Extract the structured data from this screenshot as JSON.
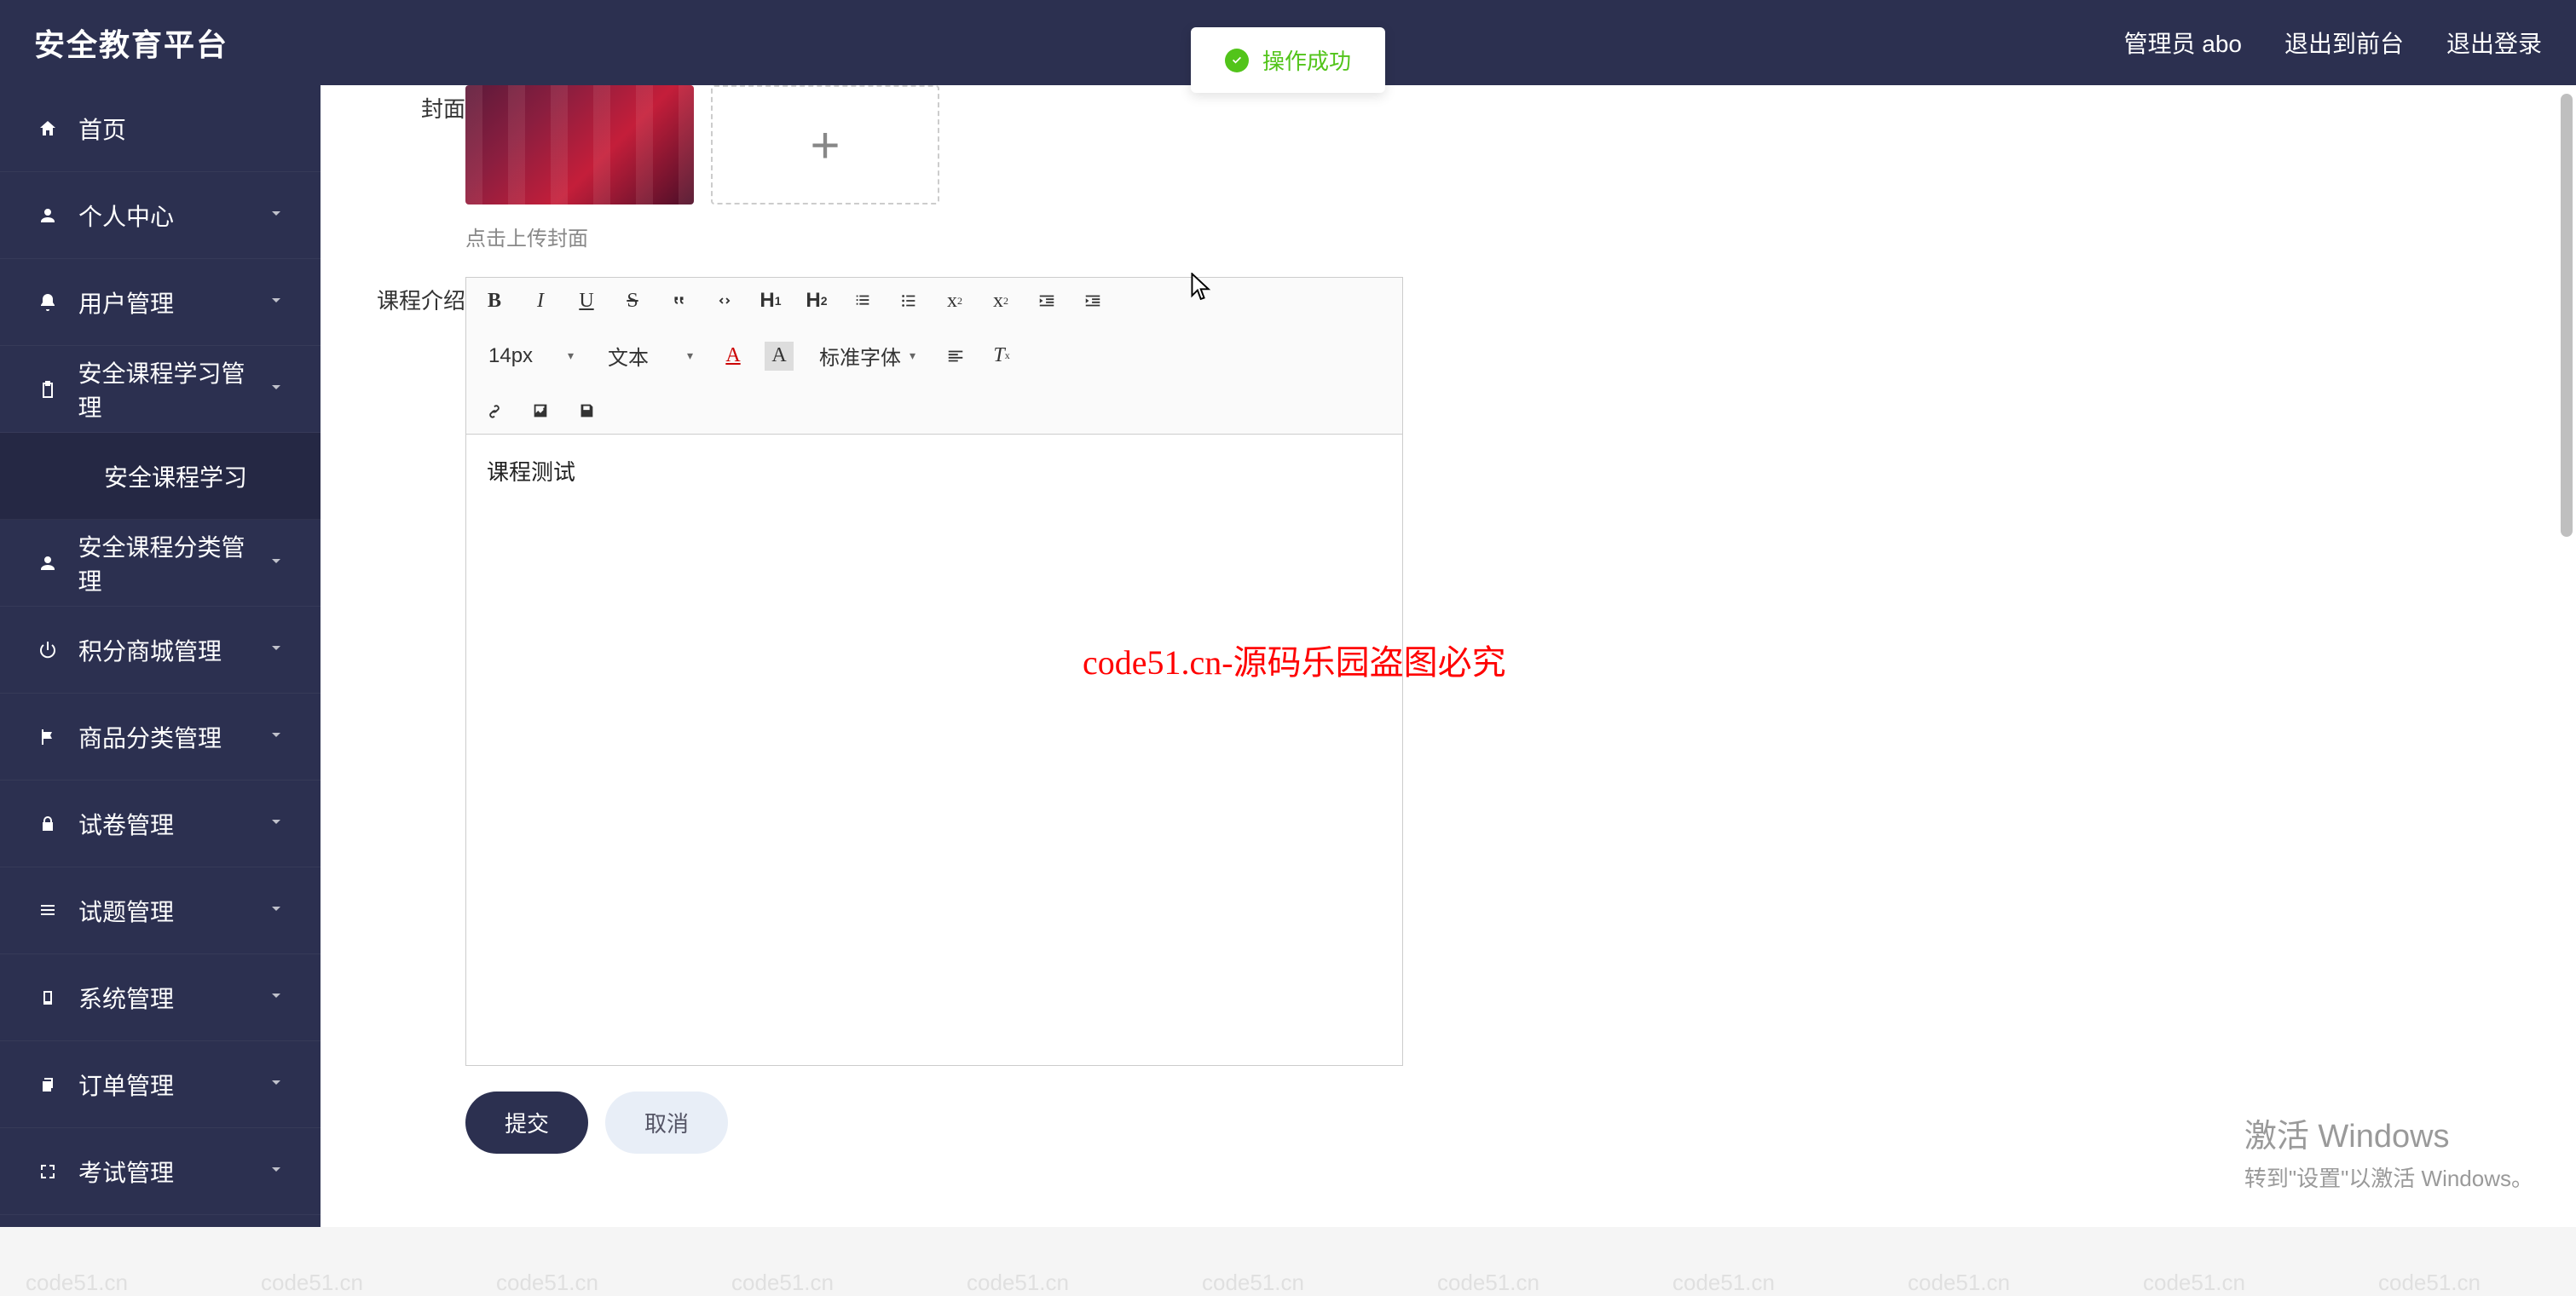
{
  "header": {
    "logo": "安全教育平台",
    "admin": "管理员 abo",
    "exit_front": "退出到前台",
    "logout": "退出登录"
  },
  "sidebar": {
    "items": [
      {
        "label": "首页",
        "icon": "home",
        "expandable": false
      },
      {
        "label": "个人中心",
        "icon": "user",
        "expandable": true
      },
      {
        "label": "用户管理",
        "icon": "bell",
        "expandable": true
      },
      {
        "label": "安全课程学习管理",
        "icon": "clipboard",
        "expandable": true
      },
      {
        "label": "安全课程学习",
        "icon": "",
        "expandable": false,
        "sub": true
      },
      {
        "label": "安全课程分类管理",
        "icon": "user",
        "expandable": true
      },
      {
        "label": "积分商城管理",
        "icon": "power",
        "expandable": true
      },
      {
        "label": "商品分类管理",
        "icon": "flag",
        "expandable": true
      },
      {
        "label": "试卷管理",
        "icon": "lock",
        "expandable": true
      },
      {
        "label": "试题管理",
        "icon": "list",
        "expandable": true
      },
      {
        "label": "系统管理",
        "icon": "device",
        "expandable": true
      },
      {
        "label": "订单管理",
        "icon": "copy",
        "expandable": true
      },
      {
        "label": "考试管理",
        "icon": "expand",
        "expandable": true
      }
    ]
  },
  "form": {
    "cover_label": "封面",
    "upload_tip": "点击上传封面",
    "intro_label": "课程介绍",
    "editor_content": "课程测试",
    "submit": "提交",
    "cancel": "取消"
  },
  "editor_toolbar": {
    "font_size": "14px",
    "format": "文本",
    "font_family": "标准字体"
  },
  "toast": {
    "text": "操作成功"
  },
  "watermark": {
    "text": "code51.cn",
    "red_text": "code51.cn-源码乐园盗图必究"
  },
  "windows": {
    "line1": "激活 Windows",
    "line2": "转到\"设置\"以激活 Windows。"
  }
}
